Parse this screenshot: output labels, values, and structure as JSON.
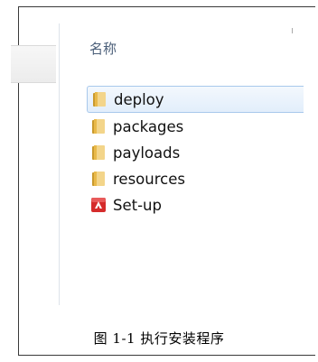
{
  "explorer": {
    "column_header": "名称",
    "files": [
      {
        "name": "deploy",
        "icon": "folder-icon",
        "selected": true
      },
      {
        "name": "packages",
        "icon": "folder-icon",
        "selected": false
      },
      {
        "name": "payloads",
        "icon": "folder-icon",
        "selected": false
      },
      {
        "name": "resources",
        "icon": "folder-icon",
        "selected": false
      },
      {
        "name": "Set-up",
        "icon": "adobe-setup-icon",
        "selected": false
      }
    ]
  },
  "caption": "图 1-1 执行安装程序",
  "colors": {
    "folder": "#e9c46a",
    "folder_dark": "#c99a2e",
    "setup_icon": "#d52b2b",
    "selection_border": "#a8c8ec",
    "header_text": "#4c607a"
  }
}
